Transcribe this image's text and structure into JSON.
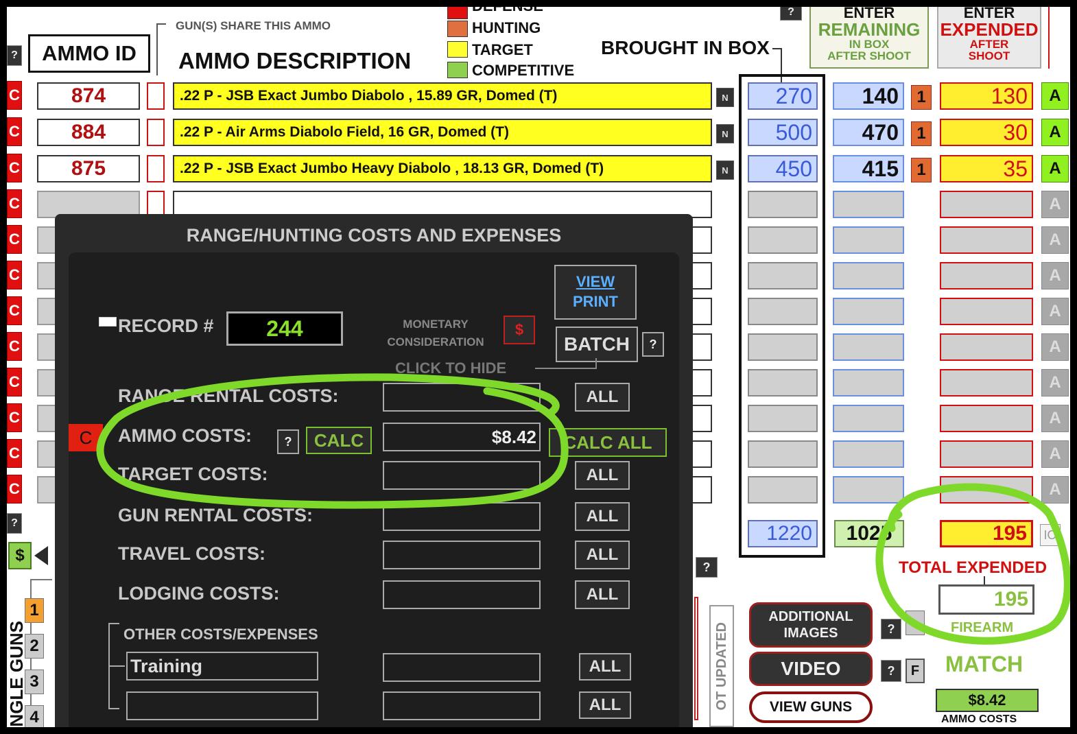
{
  "header": {
    "help": "?",
    "ammo_id": "AMMO ID",
    "share_note": "GUN(S) SHARE THIS AMMO",
    "ammo_description": "AMMO DESCRIPTION",
    "brought_in_box": "BROUGHT IN BOX",
    "remaining_enter": "ENTER",
    "remaining_title": "REMAINING",
    "remaining_sub1": "IN BOX",
    "remaining_sub2": "AFTER SHOOT",
    "expended_enter": "ENTER",
    "expended_title": "EXPENDED",
    "expended_sub1": "AFTER",
    "expended_sub2": "SHOOT"
  },
  "legend": [
    {
      "label": "DEFENSE",
      "color": "#e01010"
    },
    {
      "label": "HUNTING",
      "color": "#e07040"
    },
    {
      "label": "TARGET",
      "color": "#ffff30"
    },
    {
      "label": "COMPETITIVE",
      "color": "#90d050"
    }
  ],
  "rows": [
    {
      "c": "C",
      "id": "874",
      "desc": ".22 P - JSB Exact Jumbo Diabolo , 15.89 GR, Domed  (T)",
      "n": "N",
      "brought": "270",
      "remaining": "140",
      "one": "1",
      "expended": "130",
      "a": "A"
    },
    {
      "c": "C",
      "id": "884",
      "desc": ".22 P - Air Arms Diabolo Field, 16 GR, Domed  (T)",
      "n": "N",
      "brought": "500",
      "remaining": "470",
      "one": "1",
      "expended": "30",
      "a": "A"
    },
    {
      "c": "C",
      "id": "875",
      "desc": ".22 P - JSB Exact Jumbo Heavy Diabolo , 18.13 GR, Domed  (T)",
      "n": "N",
      "brought": "450",
      "remaining": "415",
      "one": "1",
      "expended": "35",
      "a": "A"
    },
    {
      "c": "C",
      "a": "A"
    },
    {
      "c": "C",
      "a": "A"
    },
    {
      "c": "C",
      "a": "A"
    },
    {
      "c": "C",
      "a": "A"
    },
    {
      "c": "C",
      "a": "A"
    },
    {
      "c": "C",
      "a": "A"
    },
    {
      "c": "C",
      "a": "A"
    },
    {
      "c": "C",
      "a": "A"
    },
    {
      "c": "C",
      "a": "A"
    }
  ],
  "totals": {
    "brought": "1220",
    "remaining": "1025",
    "expended": "195",
    "total_expended_label": "TOTAL EXPENDED",
    "total_expended_value": "195",
    "firearm_label": "FIREARM",
    "match_label": "MATCH",
    "ammo_costs_value": "$8.42",
    "ammo_costs_label": "AMMO COSTS",
    "cut_label": "IO"
  },
  "side": {
    "dollar": "$",
    "gun_numbers": [
      "1",
      "2",
      "3",
      "4"
    ],
    "gun_label": "NGLE GUNS",
    "not_updated": "OT UPDATED"
  },
  "buttons": {
    "additional_images": "ADDITIONAL IMAGES",
    "video": "VIDEO",
    "view_guns": "VIEW GUNS",
    "f": "F",
    "q": "?"
  },
  "modal": {
    "title": "RANGE/HUNTING COSTS AND EXPENSES",
    "record_label": "RECORD #",
    "record_value": "244",
    "monetary_line1": "MONETARY",
    "monetary_line2": "CONSIDERATION",
    "monetary_btn": "$",
    "view_print_1": "VIEW",
    "view_print_2": "PRINT",
    "batch": "BATCH",
    "click_to_hide": "CLICK TO HIDE",
    "c_btn": "C",
    "calc": "CALC",
    "calc_all": "CALC ALL",
    "all": "ALL",
    "costs": [
      {
        "label": "RANGE RENTAL COSTS:",
        "value": ""
      },
      {
        "label": "AMMO COSTS:",
        "value": "$8.42"
      },
      {
        "label": "TARGET COSTS:",
        "value": ""
      },
      {
        "label": "GUN RENTAL COSTS:",
        "value": ""
      },
      {
        "label": "TRAVEL COSTS:",
        "value": ""
      },
      {
        "label": "LODGING COSTS:",
        "value": ""
      }
    ],
    "other_label": "OTHER COSTS/EXPENSES",
    "other": [
      {
        "name": "Training",
        "value": ""
      },
      {
        "name": "",
        "value": ""
      }
    ]
  },
  "annotation_color": "#7ed92a"
}
